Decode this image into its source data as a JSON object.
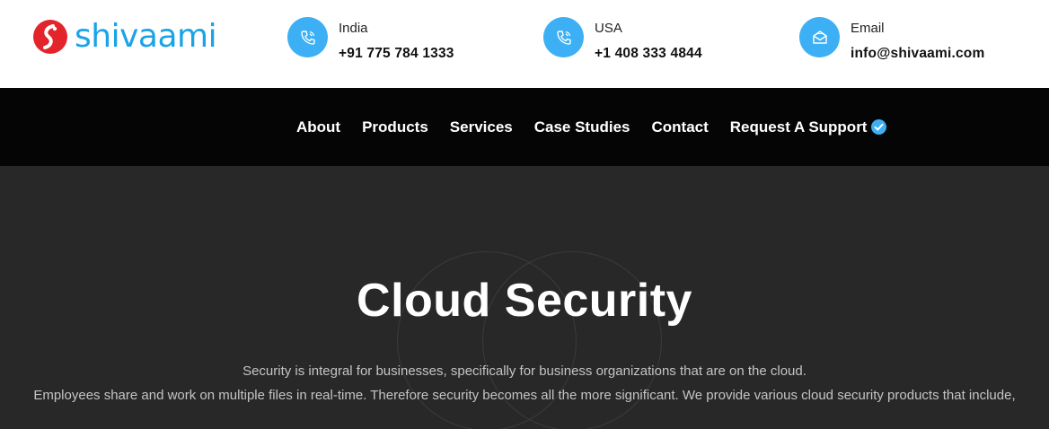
{
  "brand": {
    "name": "shivaami"
  },
  "contacts": [
    {
      "label": "India",
      "value": "+91 775 784 1333",
      "icon": "phone-icon"
    },
    {
      "label": "USA",
      "value": "+1 408 333 4844",
      "icon": "phone-icon"
    },
    {
      "label": "Email",
      "value": "info@shivaami.com",
      "icon": "mail-icon"
    }
  ],
  "nav": {
    "items": [
      "About",
      "Products",
      "Services",
      "Case Studies",
      "Contact",
      "Request A Support"
    ],
    "support_badge_icon": "verified-check-icon"
  },
  "hero": {
    "title": "Cloud Security",
    "line1": "Security is integral for businesses, specifically for business organizations that are on the cloud.",
    "line2": "Employees share and work on multiple files in real-time. Therefore security becomes all the more significant. We provide various cloud security products that include,"
  },
  "colors": {
    "accent": "#3db0f5",
    "brand_red": "#e3242b",
    "brand_blue": "#1aa3e8",
    "nav_bg": "#050505",
    "hero_bg": "#282828"
  }
}
